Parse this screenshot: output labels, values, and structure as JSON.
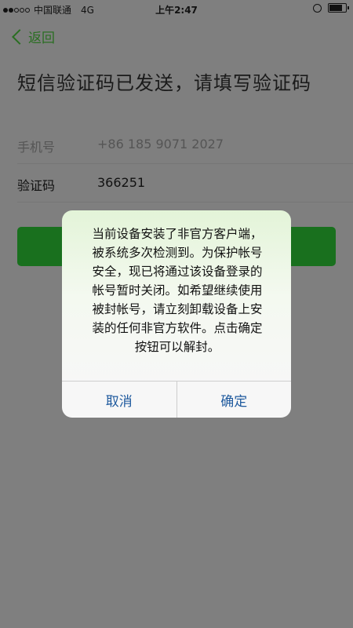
{
  "status_bar": {
    "carrier": "中国联通",
    "network": "4G",
    "time": "上午2:47",
    "signal_bars_filled": 2,
    "signal_bars_total": 5,
    "battery_level": 0.9
  },
  "nav": {
    "back_label": "返回"
  },
  "page": {
    "title": "短信验证码已发送，请填写验证码"
  },
  "form": {
    "phone_label": "手机号",
    "phone_value": "+86 185 9071 2027",
    "code_label": "验证码",
    "code_value": "366251"
  },
  "alert": {
    "message_lines": [
      "当前设备安装了非官方客户端，",
      "被系统多次检测到。为保护帐号",
      "安全，现已将通过该设备登录的",
      "帐号暂时关闭。如希望继续使用",
      "被封帐号，请立刻卸载设备上安",
      "装的任何非官方软件。点击确定",
      "按钮可以解封。"
    ],
    "cancel_label": "取消",
    "confirm_label": "确定"
  },
  "colors": {
    "accent_green": "#2a6e22",
    "button_green": "#19701e",
    "alert_button_blue": "#1f5a9e",
    "overlay_gray": "#7f7f7f"
  }
}
